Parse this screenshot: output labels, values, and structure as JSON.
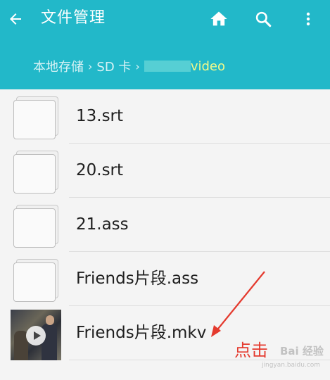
{
  "header": {
    "title": "文件管理",
    "back_icon": "arrow-left-icon",
    "home_icon": "home-icon",
    "search_icon": "search-icon",
    "menu_icon": "more-vert-icon",
    "background_color": "#22b8c9"
  },
  "breadcrumb": {
    "items": [
      "本地存储",
      "SD 卡"
    ],
    "current": "video",
    "current_color": "#f2f98a"
  },
  "files": [
    {
      "name": "13.srt",
      "icon": "generic-file-icon"
    },
    {
      "name": "20.srt",
      "icon": "generic-file-icon"
    },
    {
      "name": "21.ass",
      "icon": "generic-file-icon"
    },
    {
      "name": "Friends片段.ass",
      "icon": "generic-file-icon"
    },
    {
      "name": "Friends片段.mkv",
      "icon": "video-thumbnail"
    }
  ],
  "annotation": {
    "text": "点击",
    "color": "#e43a2e"
  },
  "watermark": {
    "text": "Bai 经验",
    "url": "jingyan.baidu.com"
  }
}
